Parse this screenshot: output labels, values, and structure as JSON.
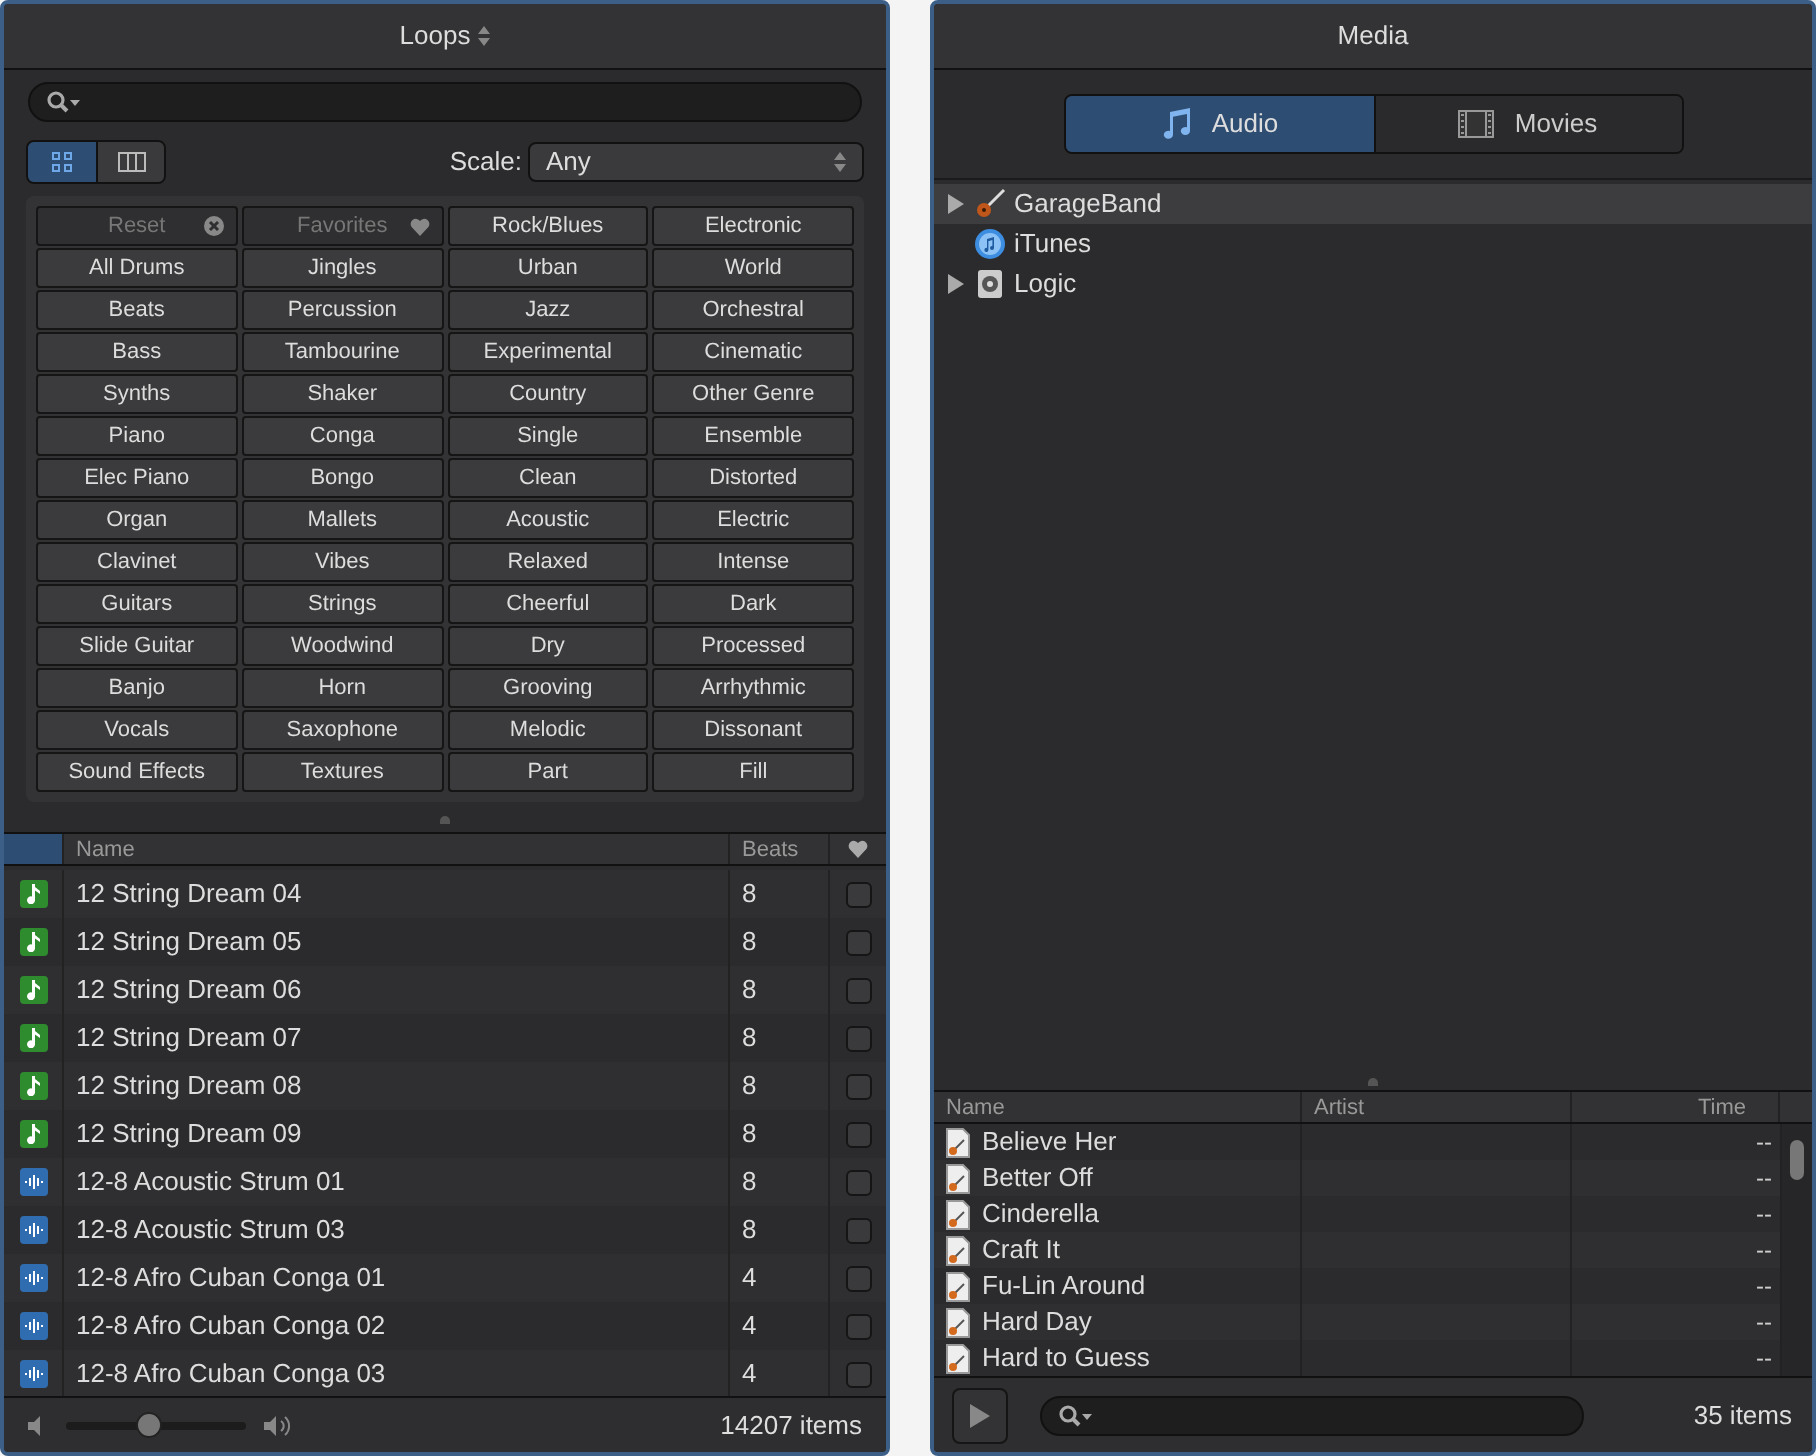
{
  "loops": {
    "title": "Loops",
    "view_modes": [
      {
        "kind": "buttons",
        "selected": true
      },
      {
        "kind": "columns",
        "selected": false
      }
    ],
    "scale": {
      "label": "Scale:",
      "value": "Any"
    },
    "keywords": [
      {
        "label": "Reset",
        "kind": "reset",
        "disabled": true
      },
      {
        "label": "Favorites",
        "kind": "favorites",
        "disabled": true
      },
      {
        "label": "Rock/Blues",
        "kind": "keyword",
        "disabled": false
      },
      {
        "label": "Electronic",
        "kind": "keyword",
        "disabled": false
      },
      {
        "label": "All Drums",
        "kind": "keyword",
        "disabled": false
      },
      {
        "label": "Jingles",
        "kind": "keyword",
        "disabled": false
      },
      {
        "label": "Urban",
        "kind": "keyword",
        "disabled": false
      },
      {
        "label": "World",
        "kind": "keyword",
        "disabled": false
      },
      {
        "label": "Beats",
        "kind": "keyword",
        "disabled": false
      },
      {
        "label": "Percussion",
        "kind": "keyword",
        "disabled": false
      },
      {
        "label": "Jazz",
        "kind": "keyword",
        "disabled": false
      },
      {
        "label": "Orchestral",
        "kind": "keyword",
        "disabled": false
      },
      {
        "label": "Bass",
        "kind": "keyword",
        "disabled": false
      },
      {
        "label": "Tambourine",
        "kind": "keyword",
        "disabled": false
      },
      {
        "label": "Experimental",
        "kind": "keyword",
        "disabled": false
      },
      {
        "label": "Cinematic",
        "kind": "keyword",
        "disabled": false
      },
      {
        "label": "Synths",
        "kind": "keyword",
        "disabled": false
      },
      {
        "label": "Shaker",
        "kind": "keyword",
        "disabled": false
      },
      {
        "label": "Country",
        "kind": "keyword",
        "disabled": false
      },
      {
        "label": "Other Genre",
        "kind": "keyword",
        "disabled": false
      },
      {
        "label": "Piano",
        "kind": "keyword",
        "disabled": false
      },
      {
        "label": "Conga",
        "kind": "keyword",
        "disabled": false
      },
      {
        "label": "Single",
        "kind": "keyword",
        "disabled": false
      },
      {
        "label": "Ensemble",
        "kind": "keyword",
        "disabled": false
      },
      {
        "label": "Elec Piano",
        "kind": "keyword",
        "disabled": false
      },
      {
        "label": "Bongo",
        "kind": "keyword",
        "disabled": false
      },
      {
        "label": "Clean",
        "kind": "keyword",
        "disabled": false
      },
      {
        "label": "Distorted",
        "kind": "keyword",
        "disabled": false
      },
      {
        "label": "Organ",
        "kind": "keyword",
        "disabled": false
      },
      {
        "label": "Mallets",
        "kind": "keyword",
        "disabled": false
      },
      {
        "label": "Acoustic",
        "kind": "keyword",
        "disabled": false
      },
      {
        "label": "Electric",
        "kind": "keyword",
        "disabled": false
      },
      {
        "label": "Clavinet",
        "kind": "keyword",
        "disabled": false
      },
      {
        "label": "Vibes",
        "kind": "keyword",
        "disabled": false
      },
      {
        "label": "Relaxed",
        "kind": "keyword",
        "disabled": false
      },
      {
        "label": "Intense",
        "kind": "keyword",
        "disabled": false
      },
      {
        "label": "Guitars",
        "kind": "keyword",
        "disabled": false
      },
      {
        "label": "Strings",
        "kind": "keyword",
        "disabled": false
      },
      {
        "label": "Cheerful",
        "kind": "keyword",
        "disabled": false
      },
      {
        "label": "Dark",
        "kind": "keyword",
        "disabled": false
      },
      {
        "label": "Slide Guitar",
        "kind": "keyword",
        "disabled": false
      },
      {
        "label": "Woodwind",
        "kind": "keyword",
        "disabled": false
      },
      {
        "label": "Dry",
        "kind": "keyword",
        "disabled": false
      },
      {
        "label": "Processed",
        "kind": "keyword",
        "disabled": false
      },
      {
        "label": "Banjo",
        "kind": "keyword",
        "disabled": false
      },
      {
        "label": "Horn",
        "kind": "keyword",
        "disabled": false
      },
      {
        "label": "Grooving",
        "kind": "keyword",
        "disabled": false
      },
      {
        "label": "Arrhythmic",
        "kind": "keyword",
        "disabled": false
      },
      {
        "label": "Vocals",
        "kind": "keyword",
        "disabled": false
      },
      {
        "label": "Saxophone",
        "kind": "keyword",
        "disabled": false
      },
      {
        "label": "Melodic",
        "kind": "keyword",
        "disabled": false
      },
      {
        "label": "Dissonant",
        "kind": "keyword",
        "disabled": false
      },
      {
        "label": "Sound Effects",
        "kind": "keyword",
        "disabled": false
      },
      {
        "label": "Textures",
        "kind": "keyword",
        "disabled": false
      },
      {
        "label": "Part",
        "kind": "keyword",
        "disabled": false
      },
      {
        "label": "Fill",
        "kind": "keyword",
        "disabled": false
      }
    ],
    "table": {
      "columns": [
        "Name",
        "Beats"
      ],
      "rows": [
        {
          "kind": "midi",
          "name": "12 String Dream 04",
          "beats": "8",
          "favorite": false
        },
        {
          "kind": "midi",
          "name": "12 String Dream 05",
          "beats": "8",
          "favorite": false
        },
        {
          "kind": "midi",
          "name": "12 String Dream 06",
          "beats": "8",
          "favorite": false
        },
        {
          "kind": "midi",
          "name": "12 String Dream 07",
          "beats": "8",
          "favorite": false
        },
        {
          "kind": "midi",
          "name": "12 String Dream 08",
          "beats": "8",
          "favorite": false
        },
        {
          "kind": "midi",
          "name": "12 String Dream 09",
          "beats": "8",
          "favorite": false
        },
        {
          "kind": "audio",
          "name": "12-8 Acoustic Strum 01",
          "beats": "8",
          "favorite": false
        },
        {
          "kind": "audio",
          "name": "12-8 Acoustic Strum 03",
          "beats": "8",
          "favorite": false
        },
        {
          "kind": "audio",
          "name": "12-8 Afro Cuban Conga 01",
          "beats": "4",
          "favorite": false
        },
        {
          "kind": "audio",
          "name": "12-8 Afro Cuban Conga 02",
          "beats": "4",
          "favorite": false
        },
        {
          "kind": "audio",
          "name": "12-8 Afro Cuban Conga 03",
          "beats": "4",
          "favorite": false
        }
      ]
    },
    "volume": {
      "level": 0.45
    },
    "status": "14207 items"
  },
  "media": {
    "title": "Media",
    "tabs": [
      {
        "label": "Audio",
        "kind": "audio",
        "selected": true
      },
      {
        "label": "Movies",
        "kind": "movies",
        "selected": false
      }
    ],
    "sources": [
      {
        "label": "GarageBand",
        "kind": "guitar",
        "expandable": true,
        "selected": true
      },
      {
        "label": "iTunes",
        "kind": "itunes",
        "expandable": false,
        "selected": false
      },
      {
        "label": "Logic",
        "kind": "logic",
        "expandable": true,
        "selected": false
      }
    ],
    "table": {
      "columns": [
        "Name",
        "Artist",
        "Time"
      ],
      "rows": [
        {
          "name": "Believe Her",
          "time": "--"
        },
        {
          "name": "Better Off",
          "time": "--"
        },
        {
          "name": "Cinderella",
          "time": "--"
        },
        {
          "name": "Craft It",
          "time": "--"
        },
        {
          "name": "Fu-Lin Around",
          "time": "--"
        },
        {
          "name": "Hard Day",
          "time": "--"
        },
        {
          "name": "Hard to Guess",
          "time": "--"
        }
      ]
    },
    "status": "35 items"
  }
}
